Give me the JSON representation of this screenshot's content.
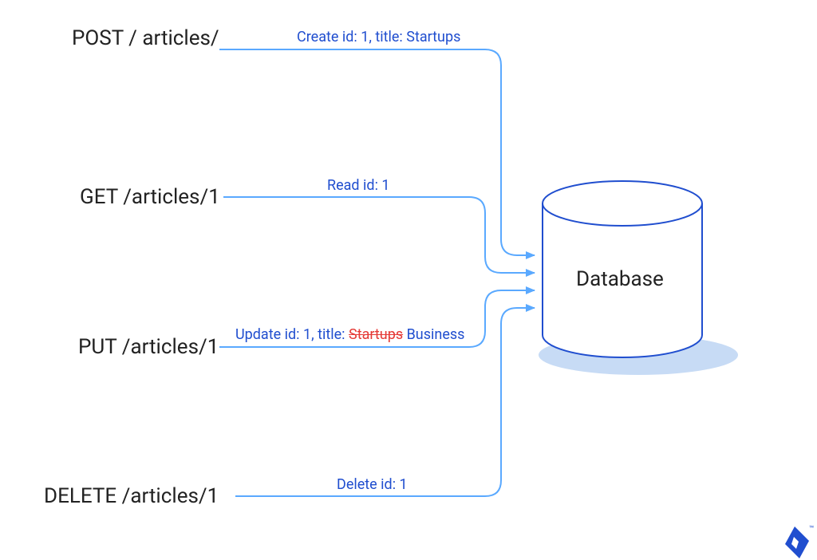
{
  "colors": {
    "blue": "#204ecf",
    "lightblue": "#5aa9ff",
    "red": "#e53935",
    "text": "#222222",
    "shadow": "#c7dbf5"
  },
  "methods": {
    "post": {
      "label": "POST / articles/",
      "action_prefix": "Create id: 1, title: Startups"
    },
    "get": {
      "label": "GET /articles/1",
      "action_prefix": "Read id: 1"
    },
    "put": {
      "label": "PUT /articles/1",
      "action_prefix": "Update id: 1, title: ",
      "strike": "Startups",
      "suffix": " Business"
    },
    "delete": {
      "label": "DELETE /articles/1",
      "action_prefix": "Delete id: 1"
    }
  },
  "database": {
    "label": "Database"
  },
  "logo": {
    "trademark": "™"
  }
}
